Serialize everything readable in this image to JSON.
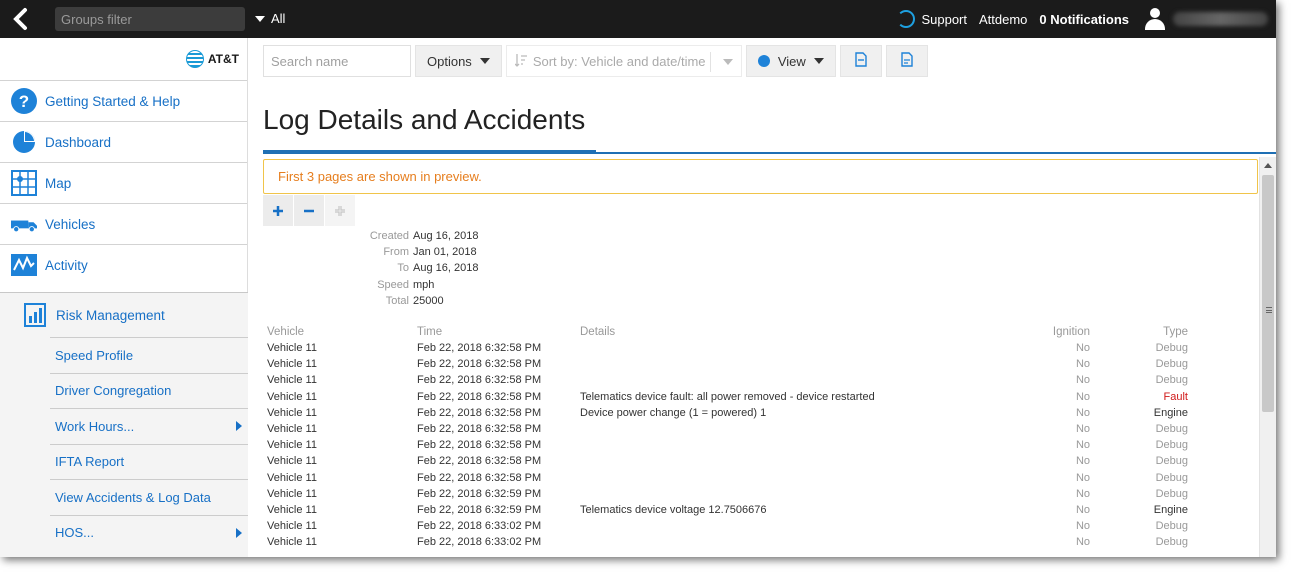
{
  "topbar": {
    "groups_filter_placeholder": "Groups filter",
    "group_selected": "All",
    "support_label": "Support",
    "user_label": "Attdemo",
    "notifications_label": "0 Notifications"
  },
  "brand": {
    "name": "AT&T"
  },
  "sidebar": {
    "items": [
      {
        "label": "Getting Started & Help",
        "icon": "help-icon"
      },
      {
        "label": "Dashboard",
        "icon": "pie-chart-icon"
      },
      {
        "label": "Map",
        "icon": "map-icon"
      },
      {
        "label": "Vehicles",
        "icon": "truck-icon"
      },
      {
        "label": "Activity",
        "icon": "activity-icon"
      }
    ],
    "risk_label": "Risk Management",
    "sub_items": [
      {
        "label": "Speed Profile",
        "has_arrow": false
      },
      {
        "label": "Driver Congregation",
        "has_arrow": false
      },
      {
        "label": "Work Hours...",
        "has_arrow": true
      },
      {
        "label": "IFTA Report",
        "has_arrow": false
      },
      {
        "label": "View Accidents & Log Data",
        "has_arrow": false
      },
      {
        "label": "HOS...",
        "has_arrow": true
      }
    ]
  },
  "toolbar": {
    "search_placeholder": "Search name",
    "options_label": "Options",
    "sort_label": "Sort by: Vehicle and date/time",
    "view_label": "View"
  },
  "page": {
    "title": "Log Details and Accidents",
    "preview_note": "First 3 pages are shown in preview."
  },
  "meta": [
    {
      "key": "Created",
      "value": "Aug 16, 2018"
    },
    {
      "key": "From",
      "value": "Jan 01, 2018"
    },
    {
      "key": "To",
      "value": "Aug 16, 2018"
    },
    {
      "key": "Speed",
      "value": "mph"
    },
    {
      "key": "Total",
      "value": "25000"
    }
  ],
  "log": {
    "columns": {
      "vehicle": "Vehicle",
      "time": "Time",
      "details": "Details",
      "ignition": "Ignition",
      "type": "Type"
    },
    "rows": [
      {
        "vehicle": "Vehicle 11",
        "time": "Feb 22, 2018 6:32:58 PM",
        "details": "",
        "ignition": "No",
        "type": "Debug"
      },
      {
        "vehicle": "Vehicle 11",
        "time": "Feb 22, 2018 6:32:58 PM",
        "details": "",
        "ignition": "No",
        "type": "Debug"
      },
      {
        "vehicle": "Vehicle 11",
        "time": "Feb 22, 2018 6:32:58 PM",
        "details": "",
        "ignition": "No",
        "type": "Debug"
      },
      {
        "vehicle": "Vehicle 11",
        "time": "Feb 22, 2018 6:32:58 PM",
        "details": "Telematics device fault: all power removed - device restarted",
        "ignition": "No",
        "type": "Fault"
      },
      {
        "vehicle": "Vehicle 11",
        "time": "Feb 22, 2018 6:32:58 PM",
        "details": "Device power change (1 = powered) 1",
        "ignition": "No",
        "type": "Engine"
      },
      {
        "vehicle": "Vehicle 11",
        "time": "Feb 22, 2018 6:32:58 PM",
        "details": "",
        "ignition": "No",
        "type": "Debug"
      },
      {
        "vehicle": "Vehicle 11",
        "time": "Feb 22, 2018 6:32:58 PM",
        "details": "",
        "ignition": "No",
        "type": "Debug"
      },
      {
        "vehicle": "Vehicle 11",
        "time": "Feb 22, 2018 6:32:58 PM",
        "details": "",
        "ignition": "No",
        "type": "Debug"
      },
      {
        "vehicle": "Vehicle 11",
        "time": "Feb 22, 2018 6:32:58 PM",
        "details": "",
        "ignition": "No",
        "type": "Debug"
      },
      {
        "vehicle": "Vehicle 11",
        "time": "Feb 22, 2018 6:32:59 PM",
        "details": "",
        "ignition": "No",
        "type": "Debug"
      },
      {
        "vehicle": "Vehicle 11",
        "time": "Feb 22, 2018 6:32:59 PM",
        "details": "Telematics device voltage 12.7506676",
        "ignition": "No",
        "type": "Engine"
      },
      {
        "vehicle": "Vehicle 11",
        "time": "Feb 22, 2018 6:33:02 PM",
        "details": "",
        "ignition": "No",
        "type": "Debug"
      },
      {
        "vehicle": "Vehicle 11",
        "time": "Feb 22, 2018 6:33:02 PM",
        "details": "",
        "ignition": "No",
        "type": "Debug"
      }
    ]
  },
  "colors": {
    "accent": "#1770c6",
    "fault": "#d01a1a",
    "warning": "#e67e1e",
    "topbar": "#1b1b1b"
  }
}
